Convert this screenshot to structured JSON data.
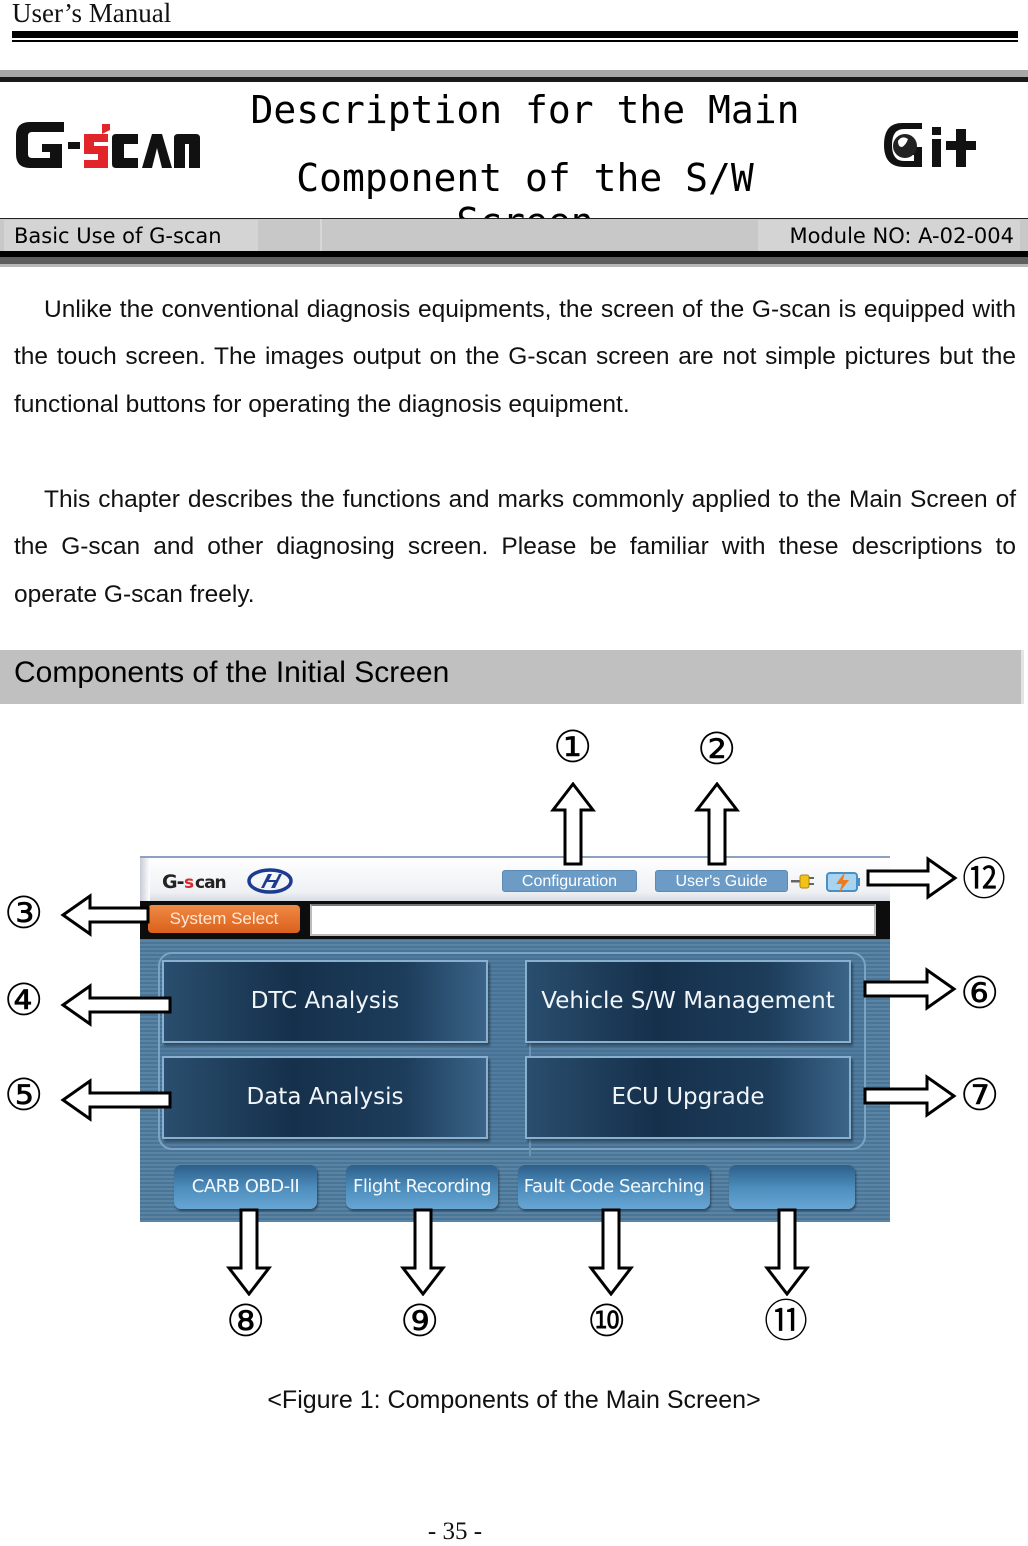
{
  "running_header": "User’s Manual",
  "header": {
    "title_line1": "Description for the Main",
    "title_line2": "Component of the S/W Screen",
    "logo_left": "G-scan",
    "logo_right": "Git",
    "category": "Basic Use of G-scan",
    "module": "Module NO: A-02-004"
  },
  "intro": {
    "paragraph1": "Unlike the conventional diagnosis equipments, the screen of the G-scan is equipped with the touch screen. The images output on the G-scan screen are not simple pictures but the functional buttons for operating the diagnosis equipment.",
    "paragraph2": "This chapter describes the functions and marks commonly applied to the Main Screen of the G-scan and other diagnosing screen. Please be familiar with these descriptions to operate G-scan freely."
  },
  "section": {
    "title": "Components of the Initial Screen"
  },
  "figure": {
    "screen": {
      "logo": "G-scan",
      "brand_logo": "hyundai-logo",
      "configuration_label": "Configuration",
      "users_guide_label": "User's Guide",
      "status_icons": [
        "plug-icon",
        "battery-charging-icon"
      ],
      "system_select_label": "System Select",
      "system_field_value": "",
      "main_buttons": [
        "DTC Analysis",
        "Vehicle S/W Management",
        "Data Analysis",
        "ECU Upgrade"
      ],
      "bottom_buttons": [
        "CARB OBD-II",
        "Flight Recording",
        "Fault Code Searching",
        ""
      ]
    },
    "callouts": [
      "①",
      "②",
      "③",
      "④",
      "⑤",
      "⑥",
      "⑦",
      "⑧",
      "⑨",
      "⑩",
      "⑪",
      "⑫"
    ],
    "caption": "<Figure 1: Components of the Main Screen>"
  },
  "page_number": "- 35 -",
  "colors": {
    "screen_blue": "#4d7696",
    "system_select_orange": "#e06a28",
    "chip_blue": "#6c9cc6",
    "section_gray": "#c0c0c0",
    "logo_red": "#e0262b"
  }
}
